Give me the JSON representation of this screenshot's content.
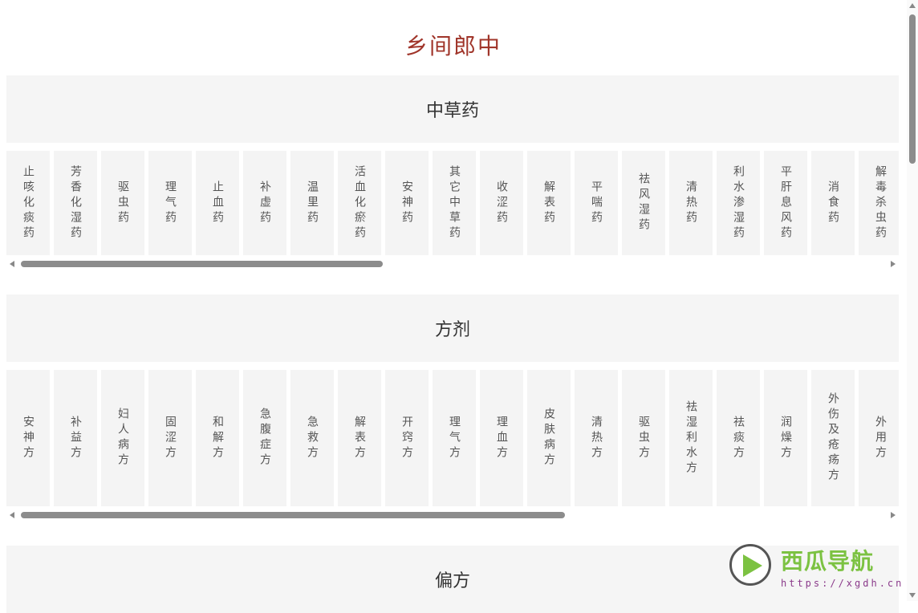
{
  "app_title": "乡间郎中",
  "sections": [
    {
      "title": "中草药",
      "items": [
        "止咳化痰药",
        "芳香化湿药",
        "驱虫药",
        "理气药",
        "止血药",
        "补虚药",
        "温里药",
        "活血化瘀药",
        "安神药",
        "其它中草药",
        "收涩药",
        "解表药",
        "平喘药",
        "祛风湿药",
        "清热药",
        "利水渗湿药",
        "平肝息风药",
        "消食药",
        "解毒杀虫药"
      ],
      "scroll_position_fraction": 0.0,
      "scroll_visible_fraction": 0.41
    },
    {
      "title": "方剂",
      "items": [
        "安神方",
        "补益方",
        "妇人病方",
        "固涩方",
        "和解方",
        "急腹症方",
        "急救方",
        "解表方",
        "开窍方",
        "理气方",
        "理血方",
        "皮肤病方",
        "清热方",
        "驱虫方",
        "祛湿利水方",
        "祛痰方",
        "润燥方",
        "外伤及疮疡方",
        "外用方"
      ],
      "scroll_position_fraction": 0.0,
      "scroll_visible_fraction": 0.61
    },
    {
      "title": "偏方",
      "items": []
    }
  ],
  "watermark": {
    "title": "西瓜导航",
    "url": "https://xgdh.cn",
    "color": "#7cc242"
  },
  "accent_color": "#a0352a"
}
